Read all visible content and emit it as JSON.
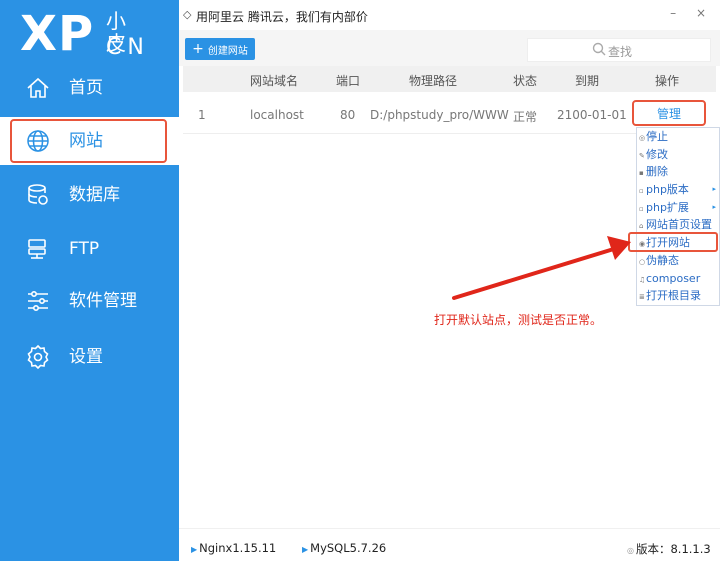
{
  "logo": {
    "main": "XP",
    "small": "小皮",
    "domain": "CN"
  },
  "sidebar": {
    "items": [
      {
        "label": "首页",
        "icon": "home-icon"
      },
      {
        "label": "网站",
        "icon": "globe-icon",
        "active": true
      },
      {
        "label": "数据库",
        "icon": "database-icon"
      },
      {
        "label": "FTP",
        "icon": "ftp-icon"
      },
      {
        "label": "软件管理",
        "icon": "sliders-icon"
      },
      {
        "label": "设置",
        "icon": "gear-icon"
      }
    ]
  },
  "titlebar": {
    "text": "用阿里云 腾讯云，我们有内部价",
    "controls": "– ×"
  },
  "toolbar": {
    "create_label": "创建网站",
    "search_placeholder": "查找"
  },
  "table": {
    "headers": [
      "网站域名",
      "端口",
      "物理路径",
      "状态",
      "到期",
      "操作"
    ],
    "rows": [
      {
        "index": "1",
        "domain": "localhost",
        "port": "80",
        "path": "D:/phpstudy_pro/WWW",
        "status": "正常",
        "expire": "2100-01-01",
        "action": "管理"
      }
    ]
  },
  "menu": {
    "items": [
      {
        "label": "停止",
        "submenu": false
      },
      {
        "label": "修改",
        "submenu": false
      },
      {
        "label": "删除",
        "submenu": false
      },
      {
        "label": "php版本",
        "submenu": true
      },
      {
        "label": "php扩展",
        "submenu": true
      },
      {
        "label": "网站首页设置",
        "submenu": false
      },
      {
        "label": "打开网站",
        "submenu": false,
        "highlighted": true
      },
      {
        "label": "伪静态",
        "submenu": false
      },
      {
        "label": "composer",
        "submenu": false
      },
      {
        "label": "打开根目录",
        "submenu": false
      }
    ]
  },
  "annotation": {
    "text": "打开默认站点，测试是否正常。",
    "color": "#e0261a"
  },
  "statusbar": {
    "nginx": "Nginx1.15.11",
    "mysql": "MySQL5.7.26",
    "version": "版本：8.1.1.3"
  },
  "colors": {
    "accent": "#2b92e4",
    "highlight": "#e8553b",
    "annotation": "#e0261a"
  }
}
